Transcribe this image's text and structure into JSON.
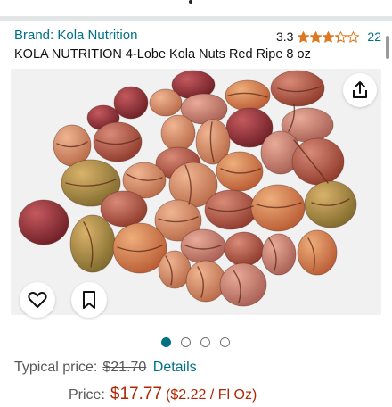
{
  "brand": {
    "label": "Brand: Kola Nutrition"
  },
  "rating": {
    "value": "3.3",
    "stars": 3.3,
    "max_stars": 5,
    "count": "22",
    "star_color": "#de7921"
  },
  "product": {
    "title": "KOLA NUTRITION 4-Lobe Kola Nuts Red Ripe 8 oz"
  },
  "image": {
    "carousel_index": 1,
    "carousel_total": 4,
    "icons": {
      "share": "share-icon",
      "wishlist": "heart-icon",
      "save": "bookmark-icon"
    }
  },
  "pricing": {
    "typical_label": "Typical price:",
    "typical_value": "$21.70",
    "details_label": "Details",
    "price_label": "Price:",
    "price_value": "$17.77",
    "unit_price": "($2.22 / Fl Oz)",
    "price_color": "#b12704",
    "link_color": "#007185"
  }
}
